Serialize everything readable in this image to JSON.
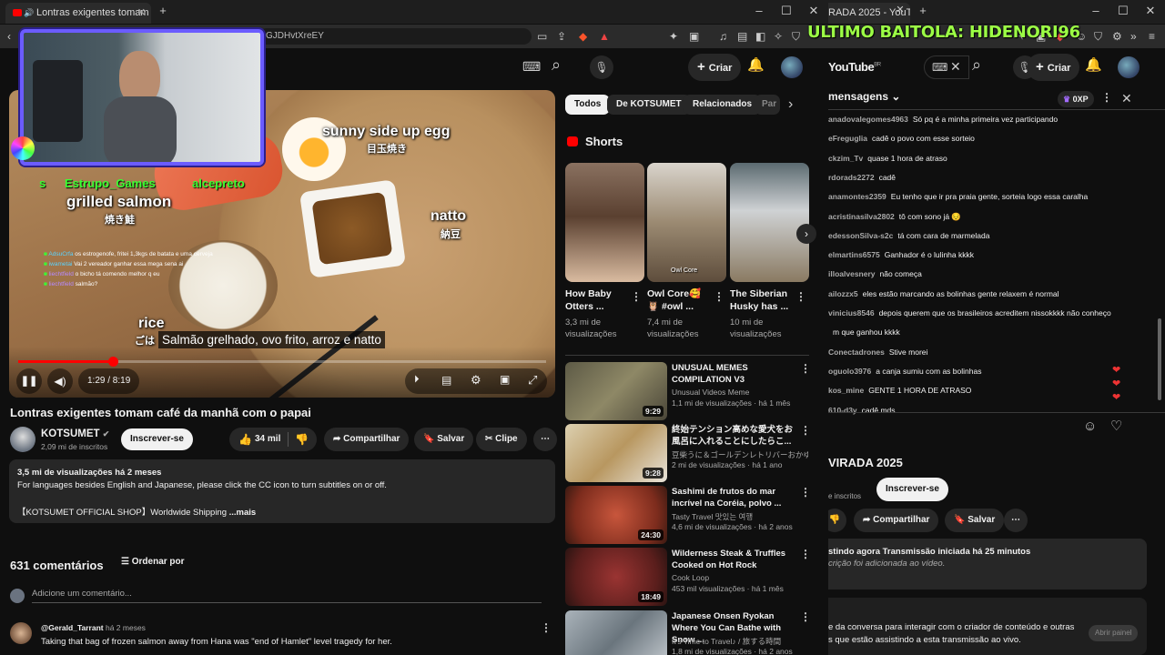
{
  "left_window": {
    "tab_title": "Lontras exigentes tomam",
    "new_tab": "+",
    "url_fragment": "GJDHvtXreEY",
    "controls": {
      "minimize": "–",
      "maximize": "☐",
      "close": "✕"
    }
  },
  "right_window": {
    "tab_title": "RADA 2025 - YouTu",
    "new_tab": "+",
    "controls": {
      "minimize": "–",
      "maximize": "☐",
      "close": "✕"
    }
  },
  "overlay_banner": "ULTIMO BAITOLA: HIDENORI96",
  "yt_header": {
    "create_label": "Criar",
    "logo": "YouTube",
    "logo_region": "BR"
  },
  "video": {
    "labels": {
      "sunny": "sunny side up egg",
      "sunny_jp": "目玉焼き",
      "salmon": "grilled salmon",
      "salmon_jp": "焼き鮭",
      "natto": "natto",
      "natto_jp": "納豆",
      "rice": "rice",
      "rice_jp": "ごは"
    },
    "subtitle": "Salmão grelhado, ovo frito, arroz e natto",
    "time": "1:29 / 8:19",
    "progress": 0.18,
    "stream_names": [
      "s",
      "Estrupo_Games",
      "alcepreto"
    ],
    "overlay_chat": [
      {
        "user": "AdsuCrfa",
        "text": "os estrogenofe, fritei 1,3kgs de batata e uma cerveja"
      },
      {
        "user": "iwametai",
        "text": "Vai 2 vereador ganhar essa mega sena ai"
      },
      {
        "user": "liechtfield",
        "text": "o bicho tá comendo melhor q eu"
      },
      {
        "user": "liechtfield",
        "text": "salmão?"
      }
    ]
  },
  "main": {
    "title": "Lontras exigentes tomam café da manhã com o papai",
    "channel": "KOTSUMET",
    "subscribers": "2,09 mi de inscritos",
    "subscribe": "Inscrever-se",
    "likes": "34 mil",
    "share": "Compartilhar",
    "save": "Salvar",
    "clip": "Clipe",
    "desc_stats": "3,5 mi de visualizações  há 2 meses",
    "desc_line1": "For languages besides English and Japanese, please click the CC icon to turn subtitles on or off.",
    "desc_line2": "【KOTSUMET OFFICIAL SHOP】Worldwide Shipping",
    "desc_more": "...mais",
    "comments_count": "631 comentários",
    "sort_by": "Ordenar por",
    "add_comment": "Adicione um comentário...",
    "first_comment_user": "@Gerald_Tarrant",
    "first_comment_time": "há 2 meses",
    "first_comment_text": "Taking that bag of frozen salmon away from Hana was \"end of Hamlet\" level tragedy for her."
  },
  "chips": [
    "Todos",
    "De KOTSUMET",
    "Relacionados",
    "Par"
  ],
  "shorts_title": "Shorts",
  "shorts": [
    {
      "title": "How Baby Otters ...",
      "views": "3,3 mi de visualizações",
      "overlay": ""
    },
    {
      "title": "Owl Core🥰 🦉 #owl ...",
      "views": "7,4 mi de visualizações",
      "overlay": "Owl Core"
    },
    {
      "title": "The Siberian Husky has ...",
      "views": "10 mi de visualizações",
      "overlay": ""
    }
  ],
  "recommended": [
    {
      "title": "UNUSUAL MEMES COMPILATION V3",
      "channel": "Unusual Videos Meme",
      "meta": "1,1 mi de visualizações · há 1 mês",
      "duration": "9:29",
      "color": "#6e6a52"
    },
    {
      "title": "終始テンション高めな愛犬をお風呂に入れることにしたらこ...",
      "channel": "豆柴うに＆ゴールデンレトリバーおかゆ...",
      "meta": "2 mi de visualizações · há 1 ano",
      "duration": "9:28",
      "color": "#c9b58a"
    },
    {
      "title": "Sashimi de frutos do mar incrível na Coréia, polvo ...",
      "channel": "Tasty Travel 맛있는 여행",
      "meta": "4,6 mi de visualizações · há 2 anos",
      "duration": "24:30",
      "color": "#9a3e2a"
    },
    {
      "title": "Wilderness Steak & Truffles Cooked on Hot Rock",
      "channel": "Cook Loop",
      "meta": "453 mil visualizações · há 1 mês",
      "duration": "18:49",
      "color": "#6a2a26"
    },
    {
      "title": "Japanese Onsen Ryokan Where You Can Bathe with Snow ...",
      "channel": "It's Time to Travel♪ / 旅する時間",
      "meta": "1,8 mi de visualizações · há 2 anos",
      "duration": "",
      "color": "#7d8890"
    }
  ],
  "live_chat": {
    "header": "mensagens",
    "xp": "0XP",
    "messages": [
      {
        "user": "anadovalegomes4963",
        "text": "Só pq é a minha primeira vez participando"
      },
      {
        "user": "eFreguglia",
        "text": "cadê o povo com esse sorteio"
      },
      {
        "user": "ckzim_Tv",
        "text": "quase 1 hora de atraso"
      },
      {
        "user": "rdorads2272",
        "text": "cadê"
      },
      {
        "user": "anamontes2359",
        "text": "Eu tenho que ir pra praia gente, sorteia logo essa caralha"
      },
      {
        "user": "acristinasilva2802",
        "text": "tô com sono já 😔"
      },
      {
        "user": "edessonSilva-s2c",
        "text": "tá com cara de marmelada"
      },
      {
        "user": "elmartins6575",
        "text": "Ganhador é o lulinha kkkk"
      },
      {
        "user": "illoalvesnery",
        "text": "não começa"
      },
      {
        "user": "ailozzx5",
        "text": "eles estão marcando as bolinhas gente relaxem é normal"
      },
      {
        "user": "vinicius8546",
        "text": "depois querem que os brasileiros acreditem nissokkkk não conheço"
      },
      {
        "user": "",
        "text": "m que ganhou kkkk"
      },
      {
        "user": "Conectadrones",
        "text": "Stive morei"
      },
      {
        "user": "oguolo3976",
        "text": "a canja sumiu com as bolinhas"
      },
      {
        "user": "kos_mine",
        "text": "GENTE 1 HORA DE ATRASO"
      },
      {
        "user": "610-d3y",
        "text": "cadê mds"
      }
    ]
  },
  "live_info": {
    "title": "VIRADA 2025",
    "subscribers_fragment": "e inscritos",
    "subscribe": "Inscrever-se",
    "share": "Compartilhar",
    "save": "Salvar",
    "watching": "stindo agora  Transmissão iniciada há 25 minutos",
    "desc": "crição foi adicionada ao vídeo.",
    "chat_prompt_line1": "e da conversa para interagir com o criador de conteúdo e outras",
    "chat_prompt_line2": "s que estão assistindo a esta transmissão ao vivo.",
    "open_panel": "Abrir painel"
  }
}
